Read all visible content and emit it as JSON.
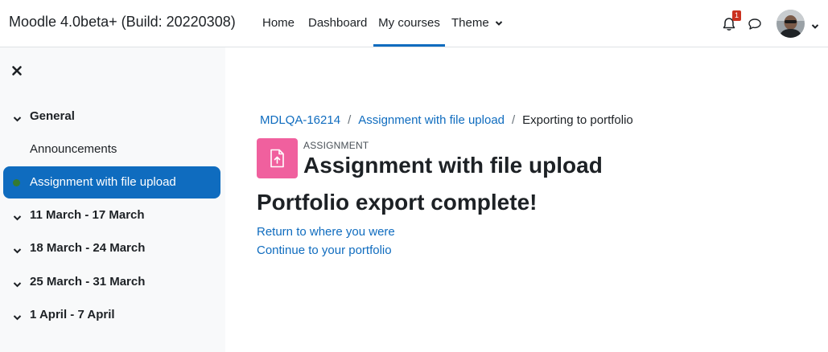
{
  "navbar": {
    "brand": "Moodle 4.0beta+ (Build: 20220308)",
    "items": [
      {
        "label": "Home"
      },
      {
        "label": "Dashboard"
      },
      {
        "label": "My courses",
        "active": true
      },
      {
        "label": "Theme"
      }
    ],
    "notification_count": "1",
    "accent_color": "#0f6cbf",
    "badge_color": "#ca3120",
    "icons": [
      "bell-icon",
      "message-icon",
      "avatar",
      "chevron-down-icon"
    ]
  },
  "drawer": {
    "close_icon": "close-icon",
    "sections": [
      {
        "label": "General",
        "expanded": true
      },
      {
        "label": "11 March - 17 March"
      },
      {
        "label": "18 March - 24 March"
      },
      {
        "label": "25 March - 31 March"
      },
      {
        "label": "1 April - 7 April"
      }
    ],
    "activities": [
      {
        "label": "Announcements"
      },
      {
        "label": "Assignment with file upload",
        "active": true
      }
    ]
  },
  "breadcrumb": {
    "items": [
      "MDLQA-16214",
      "Assignment with file upload"
    ],
    "current": "Exporting to portfolio",
    "separator": "/"
  },
  "activity": {
    "kind": "ASSIGNMENT",
    "title": "Assignment with file upload",
    "icon": "assignment-upload-icon",
    "icon_color": "#f0609e"
  },
  "main": {
    "heading": "Portfolio export complete!",
    "links": {
      "return": "Return to where you were",
      "continue": "Continue to your portfolio"
    }
  }
}
